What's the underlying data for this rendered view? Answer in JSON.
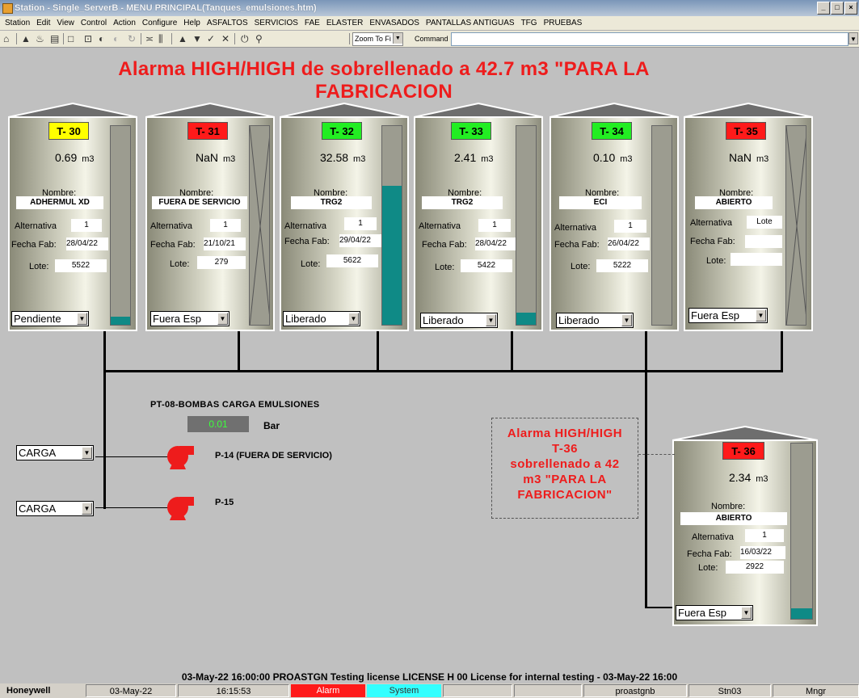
{
  "window": {
    "title": "Station - Single_ServerB - MENU PRINCIPAL(Tanques_emulsiones.htm)",
    "controls": [
      "_",
      "□",
      "×"
    ]
  },
  "menu": [
    "Station",
    "Edit",
    "View",
    "Control",
    "Action",
    "Configure",
    "Help",
    "ASFALTOS",
    "SERVICIOS",
    "FAE",
    "ELASTER",
    "ENVASADOS",
    "PANTALLAS ANTIGUAS",
    "TFG",
    "PRUEBAS"
  ],
  "toolbar": {
    "zoom_label": "Zoom To Fi",
    "command_label": "Command",
    "command_value": ""
  },
  "banner": {
    "line1": "Alarma HIGH/HIGH de sobrellenado  a 42.7 m3 \"PARA LA",
    "line2": "FABRICACION"
  },
  "colors": {
    "tag_yellow": "#ffff00",
    "tag_red": "#ff1a1a",
    "tag_green": "#22ee22",
    "alarm_red": "#ee1c1c",
    "level_fill": "#0f8a86",
    "pt_value": "#3cff3c"
  },
  "tanks": [
    {
      "tag": "T- 30",
      "tag_color": "#ffff00",
      "volume": "0.69",
      "unit": "m3",
      "name_label": "Nombre:",
      "name": "ADHERMUL XD",
      "alt_label": "Alternativa",
      "alt": "1",
      "fecha_label": "Fecha Fab:",
      "fecha": "28/04/22",
      "lote_label": "Lote:",
      "lote": "5522",
      "status": "Pendiente",
      "level": 0.03
    },
    {
      "tag": "T- 31",
      "tag_color": "#ff1a1a",
      "volume": "NaN",
      "unit": "m3",
      "name_label": "Nombre:",
      "name": "FUERA DE SERVICIO",
      "alt_label": "Alternativa",
      "alt": "1",
      "fecha_label": "Fecha Fab:",
      "fecha": "21/10/21",
      "lote_label": "Lote:",
      "lote": "279",
      "status": "Fuera Esp",
      "level": 0
    },
    {
      "tag": "T- 32",
      "tag_color": "#22ee22",
      "volume": "32.58",
      "unit": "m3",
      "name_label": "Nombre:",
      "name": "TRG2",
      "alt_label": "Alternativa",
      "alt": "1",
      "fecha_label": "Fecha Fab:",
      "fecha": "29/04/22",
      "lote_label": "Lote:",
      "lote": "5622",
      "status": "Liberado",
      "level": 0.7
    },
    {
      "tag": "T- 33",
      "tag_color": "#22ee22",
      "volume": "2.41",
      "unit": "m3",
      "name_label": "Nombre:",
      "name": "TRG2",
      "alt_label": "Alternativa",
      "alt": "1",
      "fecha_label": "Fecha Fab:",
      "fecha": "28/04/22",
      "lote_label": "Lote:",
      "lote": "5422",
      "status": "Liberado",
      "level": 0.06
    },
    {
      "tag": "T- 34",
      "tag_color": "#22ee22",
      "volume": "0.10",
      "unit": "m3",
      "name_label": "Nombre:",
      "name": "ECI",
      "alt_label": "Alternativa",
      "alt": "1",
      "fecha_label": "Fecha Fab:",
      "fecha": "26/04/22",
      "lote_label": "Lote:",
      "lote": "5222",
      "status": "Liberado",
      "level": 0
    },
    {
      "tag": "T- 35",
      "tag_color": "#ff1a1a",
      "volume": "NaN",
      "unit": "m3",
      "name_label": "Nombre:",
      "name": "ABIERTO",
      "alt_label": "Alternativa",
      "alt": "Lote",
      "fecha_label": "Fecha Fab:",
      "fecha": "",
      "lote_label": "Lote:",
      "lote": "",
      "status": "Fuera Esp",
      "level": 0
    },
    {
      "tag": "T- 36",
      "tag_color": "#ff1a1a",
      "volume": "2.34",
      "unit": "m3",
      "name_label": "Nombre:",
      "name": "ABIERTO",
      "alt_label": "Alternativa",
      "alt": "1",
      "fecha_label": "Fecha Fab:",
      "fecha": "16/03/22",
      "lote_label": "Lote:",
      "lote": "2922",
      "status": "Fuera Esp",
      "level": 0.06
    }
  ],
  "pump_section": {
    "title": "PT-08-BOMBAS CARGA EMULSIONES",
    "pressure_value": "0.01",
    "pressure_unit": "Bar",
    "pumps": [
      {
        "mode": "CARGA",
        "label": "P-14 (FUERA DE SERVICIO)"
      },
      {
        "mode": "CARGA",
        "label": "P-15"
      }
    ]
  },
  "alarm_note": [
    "Alarma HIGH/HIGH",
    "T-36",
    "sobrellenado  a 42",
    "m3 \"PARA LA",
    "FABRICACION\""
  ],
  "license_line": "03-May-22  16:00:00  PROASTGN   Testing license   LICENSE   H 00 License for internal testing - 03-May-22  16:00",
  "status_bar": {
    "brand": "Honeywell",
    "date": "03-May-22",
    "time": "16:15:53",
    "alarm": "Alarm",
    "system": "System",
    "server": "proastgnb",
    "station": "Stn03",
    "role": "Mngr"
  }
}
